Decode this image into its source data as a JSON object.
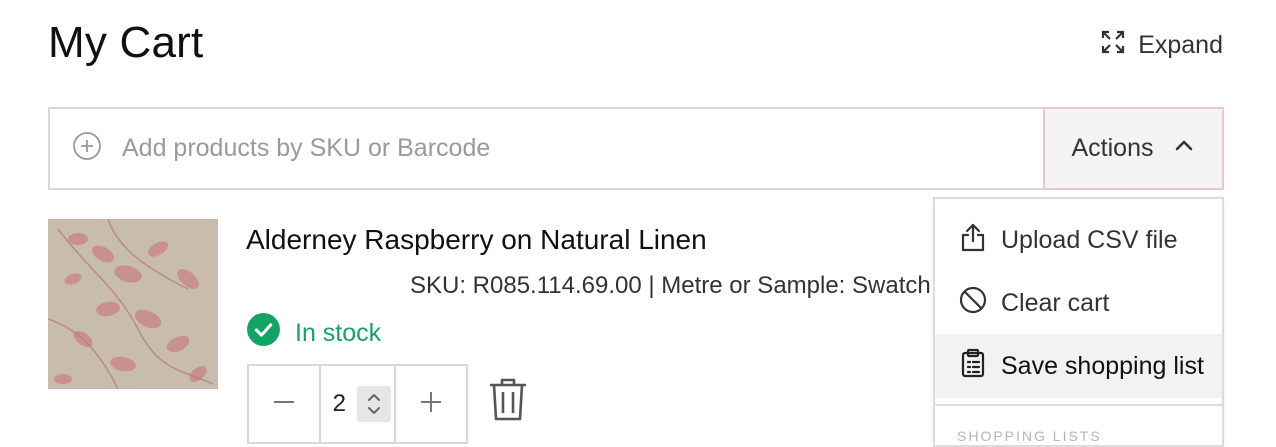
{
  "page": {
    "title": "My Cart",
    "expand_label": "Expand"
  },
  "add_products": {
    "placeholder": "Add products by SKU or Barcode",
    "actions_label": "Actions"
  },
  "cart_item": {
    "name": "Alderney Raspberry on Natural Linen",
    "sku_line": "SKU: R085.114.69.00 | Metre or Sample: Swatch",
    "stock_status": "In stock",
    "quantity": "2"
  },
  "actions_menu": {
    "items": [
      {
        "label": "Upload CSV file",
        "icon": "upload-icon"
      },
      {
        "label": "Clear cart",
        "icon": "ban-icon"
      },
      {
        "label": "Save shopping list",
        "icon": "clipboard-list-icon"
      }
    ],
    "section_label": "SHOPPING LISTS"
  },
  "colors": {
    "stock_green": "#13a463",
    "actions_border": "#e8c8c8",
    "active_item_bg": "#f2f2f2"
  }
}
